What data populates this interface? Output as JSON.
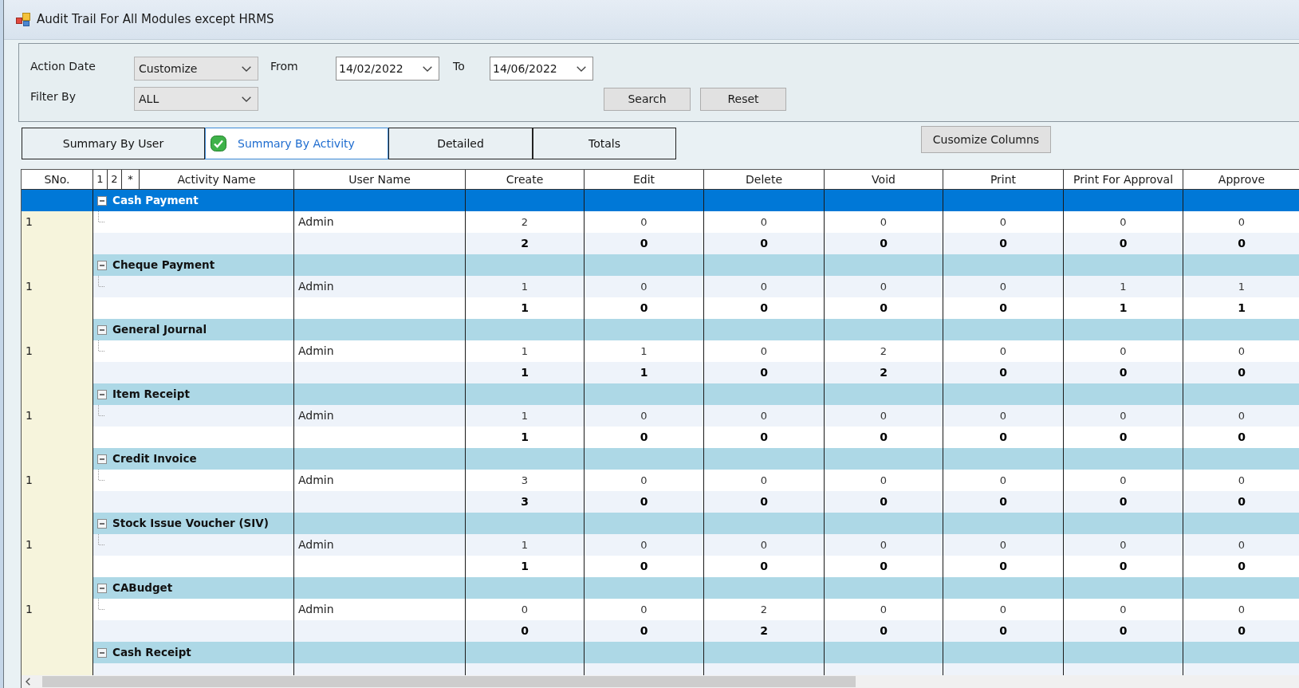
{
  "window": {
    "title": "Audit Trail For All Modules except HRMS"
  },
  "filters": {
    "action_date": {
      "label": "Action Date",
      "value": "Customize"
    },
    "from": {
      "label": "From",
      "value": "14/02/2022"
    },
    "to": {
      "label": "To",
      "value": "14/06/2022"
    },
    "filter_by": {
      "label": "Filter By",
      "value": "ALL"
    },
    "buttons": [
      "Search",
      "Reset"
    ]
  },
  "tabs": [
    {
      "label": "Summary By User",
      "selected": false
    },
    {
      "label": "Summary By Activity",
      "selected": true
    },
    {
      "label": "Detailed",
      "selected": false
    },
    {
      "label": "Totals",
      "selected": false
    }
  ],
  "customize_button": "Cusomize Columns",
  "table": {
    "columns": [
      "SNo.",
      "1",
      "2",
      "*",
      "Activity Name",
      "User Name",
      "Create",
      "Edit",
      "Delete",
      "Void",
      "Print",
      "Print For Approval",
      "Approve"
    ],
    "groups": [
      {
        "name": "Cash Payment",
        "selected": true,
        "expanded": true,
        "rows": [
          {
            "sno": "1",
            "user": "Admin",
            "values": [
              "2",
              "0",
              "0",
              "0",
              "0",
              "0",
              "0"
            ]
          }
        ],
        "totals": [
          "2",
          "0",
          "0",
          "0",
          "0",
          "0",
          "0"
        ]
      },
      {
        "name": "Cheque Payment",
        "selected": false,
        "expanded": true,
        "rows": [
          {
            "sno": "1",
            "user": "Admin",
            "values": [
              "1",
              "0",
              "0",
              "0",
              "0",
              "1",
              "1"
            ]
          }
        ],
        "totals": [
          "1",
          "0",
          "0",
          "0",
          "0",
          "1",
          "1"
        ]
      },
      {
        "name": "General Journal",
        "selected": false,
        "expanded": true,
        "rows": [
          {
            "sno": "1",
            "user": "Admin",
            "values": [
              "1",
              "1",
              "0",
              "2",
              "0",
              "0",
              "0"
            ]
          }
        ],
        "totals": [
          "1",
          "1",
          "0",
          "2",
          "0",
          "0",
          "0"
        ]
      },
      {
        "name": "Item Receipt",
        "selected": false,
        "expanded": true,
        "rows": [
          {
            "sno": "1",
            "user": "Admin",
            "values": [
              "1",
              "0",
              "0",
              "0",
              "0",
              "0",
              "0"
            ]
          }
        ],
        "totals": [
          "1",
          "0",
          "0",
          "0",
          "0",
          "0",
          "0"
        ]
      },
      {
        "name": "Credit Invoice",
        "selected": false,
        "expanded": true,
        "rows": [
          {
            "sno": "1",
            "user": "Admin",
            "values": [
              "3",
              "0",
              "0",
              "0",
              "0",
              "0",
              "0"
            ]
          }
        ],
        "totals": [
          "3",
          "0",
          "0",
          "0",
          "0",
          "0",
          "0"
        ]
      },
      {
        "name": "Stock Issue Voucher (SIV)",
        "selected": false,
        "expanded": true,
        "rows": [
          {
            "sno": "1",
            "user": "Admin",
            "values": [
              "1",
              "0",
              "0",
              "0",
              "0",
              "0",
              "0"
            ]
          }
        ],
        "totals": [
          "1",
          "0",
          "0",
          "0",
          "0",
          "0",
          "0"
        ]
      },
      {
        "name": "CABudget",
        "selected": false,
        "expanded": true,
        "rows": [
          {
            "sno": "1",
            "user": "Admin",
            "values": [
              "0",
              "0",
              "2",
              "0",
              "0",
              "0",
              "0"
            ]
          }
        ],
        "totals": [
          "0",
          "0",
          "2",
          "0",
          "0",
          "0",
          "0"
        ]
      },
      {
        "name": "Cash Receipt",
        "selected": false,
        "expanded": true
      }
    ]
  }
}
